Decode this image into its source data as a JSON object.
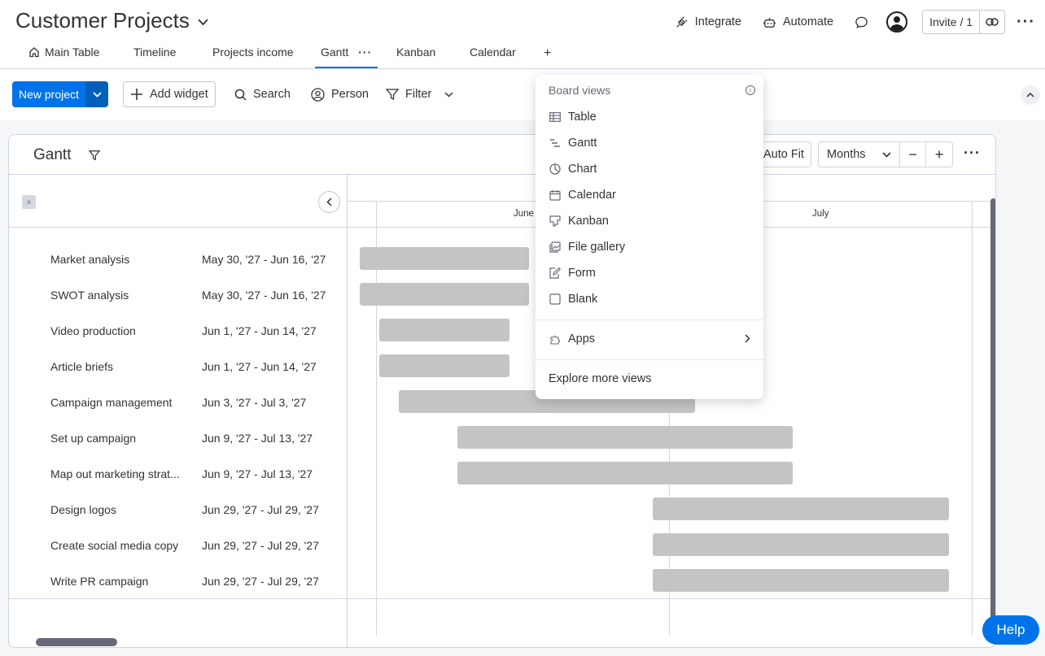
{
  "board": {
    "title": "Customer Projects"
  },
  "top_actions": {
    "integrate": "Integrate",
    "automate": "Automate",
    "invite": "Invite / 1"
  },
  "tabs": [
    {
      "label": "Main Table"
    },
    {
      "label": "Timeline"
    },
    {
      "label": "Projects income"
    },
    {
      "label": "Gantt"
    },
    {
      "label": "Kanban"
    },
    {
      "label": "Calendar"
    }
  ],
  "toolbar": {
    "new_project": "New project",
    "add_widget": "Add widget",
    "search": "Search",
    "person": "Person",
    "filter": "Filter"
  },
  "gantt": {
    "title": "Gantt",
    "auto_fit": "Auto Fit",
    "scale": "Months",
    "months": [
      "June",
      "July"
    ]
  },
  "items": [
    {
      "name": "Market analysis",
      "dates": "May 30, '27 - Jun 16, '27"
    },
    {
      "name": "SWOT analysis",
      "dates": "May 30, '27 - Jun 16, '27"
    },
    {
      "name": "Video production",
      "dates": "Jun 1, '27 - Jun 14, '27"
    },
    {
      "name": "Article briefs",
      "dates": "Jun 1, '27 - Jun 14, '27"
    },
    {
      "name": "Campaign management",
      "dates": "Jun 3, '27 - Jul 3, '27"
    },
    {
      "name": "Set up campaign",
      "dates": "Jun 9, '27 - Jul 13, '27"
    },
    {
      "name": "Map out marketing strat...",
      "dates": "Jun 9, '27 - Jul 13, '27"
    },
    {
      "name": "Design logos",
      "dates": "Jun 29, '27 - Jul 29, '27"
    },
    {
      "name": "Create social media copy",
      "dates": "Jun 29, '27 - Jul 29, '27"
    },
    {
      "name": "Write PR campaign",
      "dates": "Jun 29, '27 - Jul 29, '27"
    }
  ],
  "menu": {
    "header": "Board views",
    "views": [
      {
        "label": "Table",
        "icon": "table-icon"
      },
      {
        "label": "Gantt",
        "icon": "gantt-icon"
      },
      {
        "label": "Chart",
        "icon": "chart-icon"
      },
      {
        "label": "Calendar",
        "icon": "calendar-icon"
      },
      {
        "label": "Kanban",
        "icon": "kanban-icon"
      },
      {
        "label": "File gallery",
        "icon": "file-gallery-icon"
      },
      {
        "label": "Form",
        "icon": "form-icon"
      },
      {
        "label": "Blank",
        "icon": "blank-icon"
      }
    ],
    "apps": "Apps",
    "explore": "Explore more views"
  },
  "help": "Help"
}
